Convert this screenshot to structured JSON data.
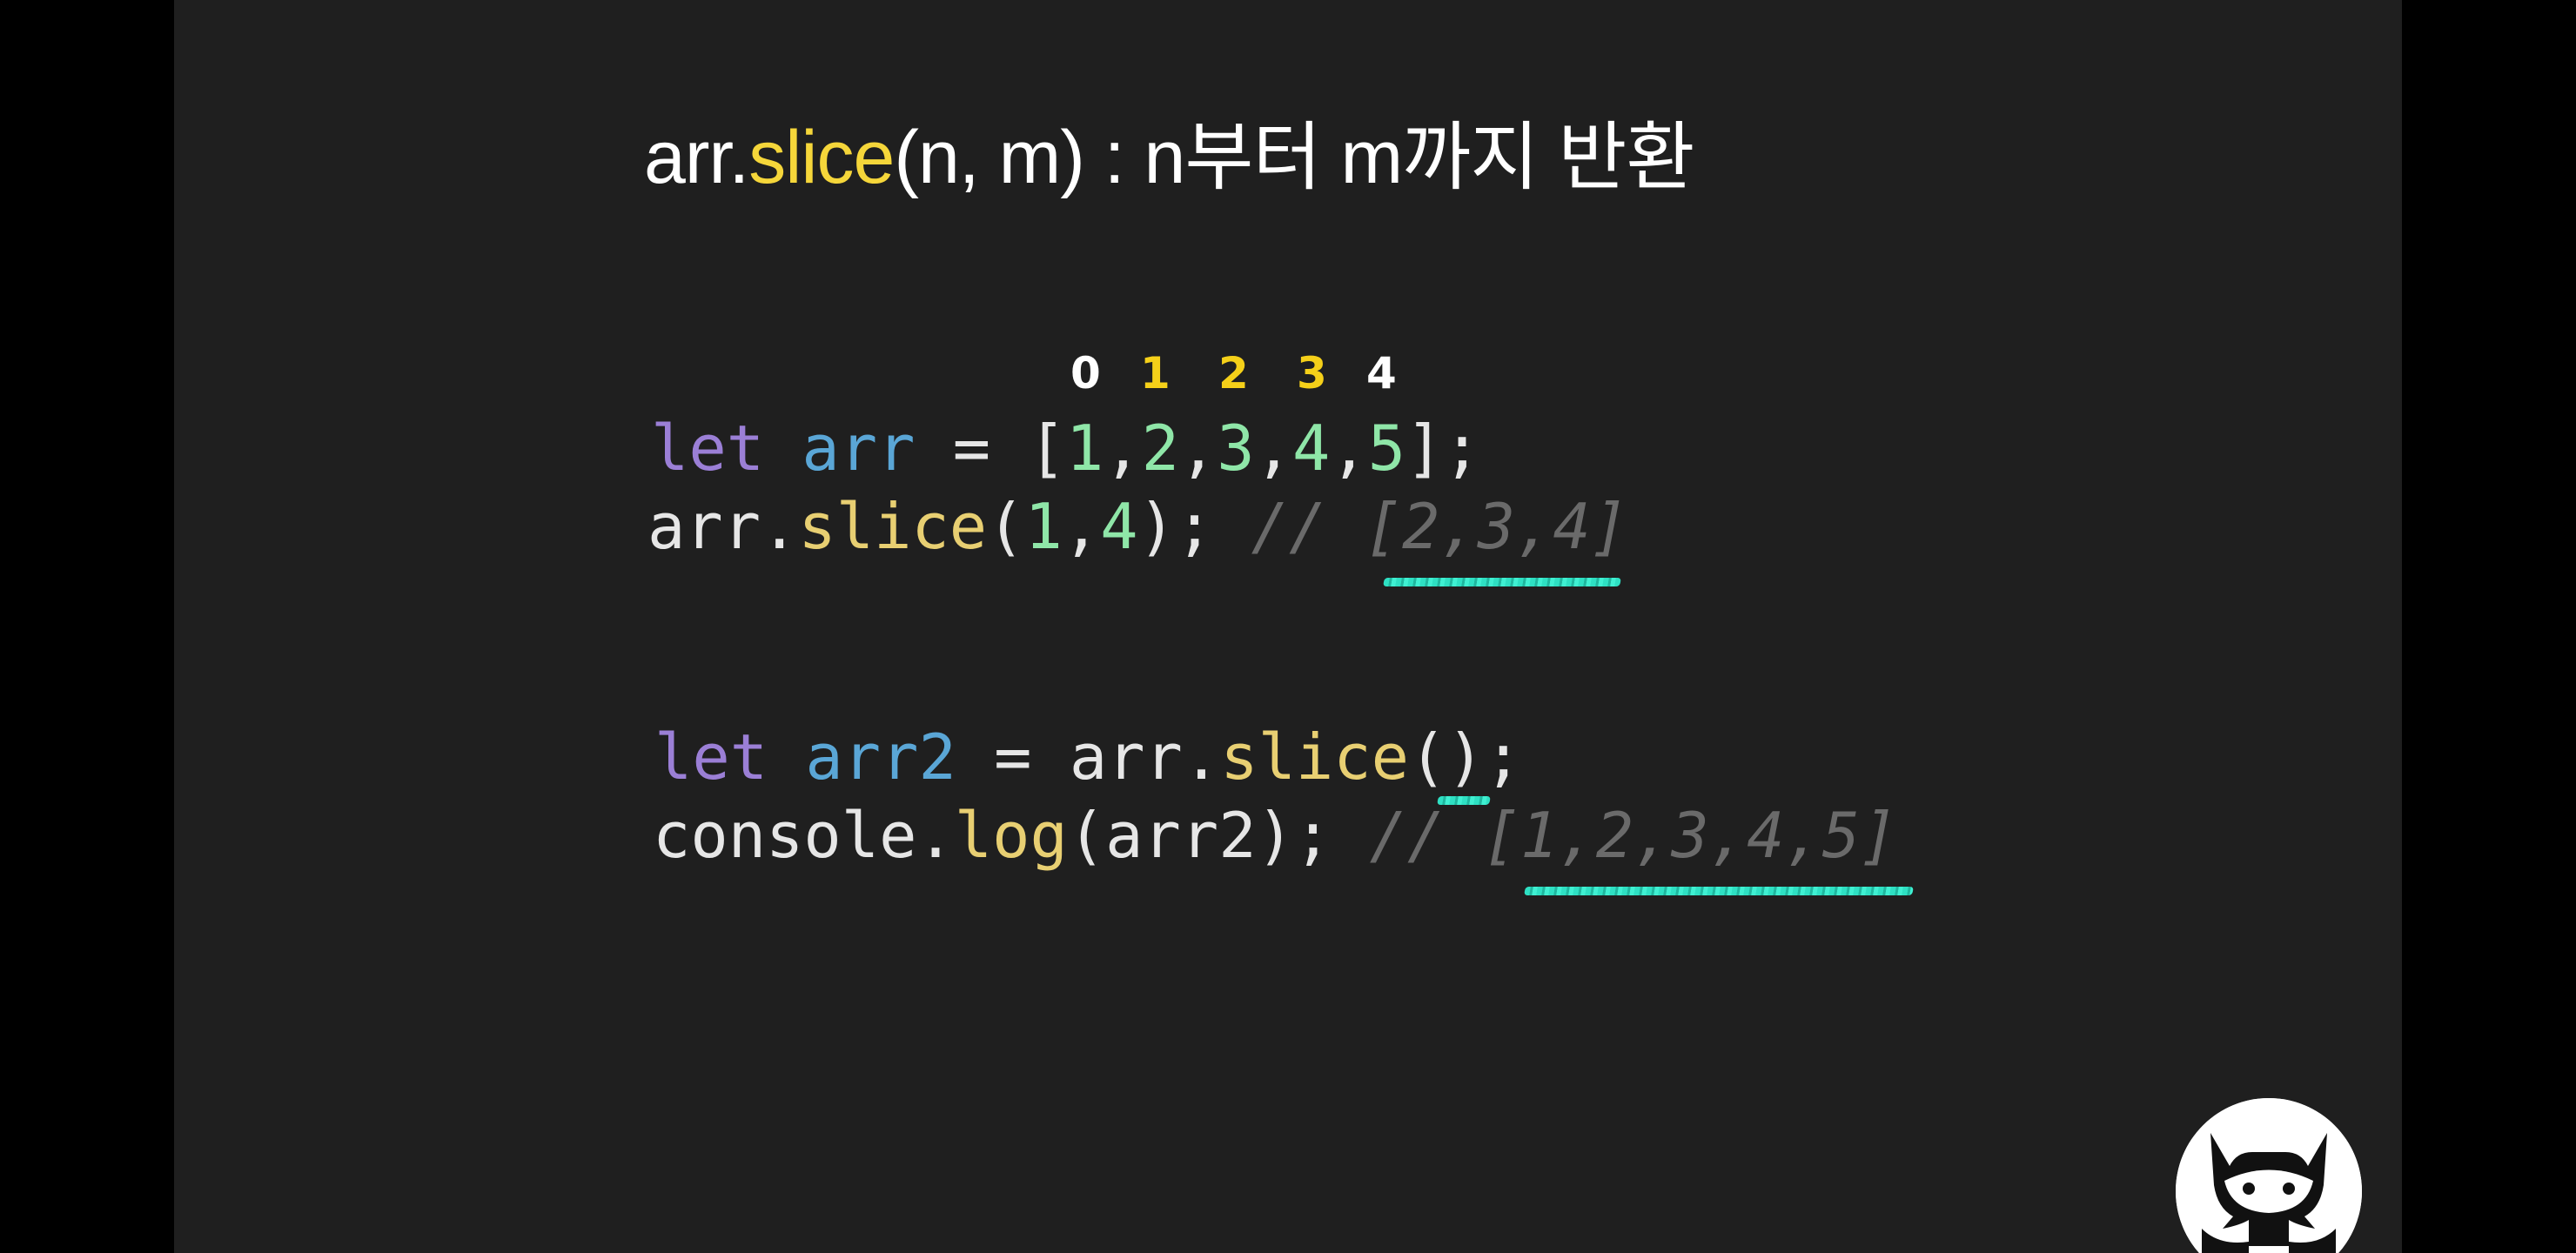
{
  "slide": {
    "title": {
      "prefix": "arr.",
      "method": "slice",
      "suffix": "(n, m) : n부터 m까지 반환"
    },
    "indices": [
      "0",
      "1",
      "2",
      "3",
      "4"
    ],
    "code_block_1": {
      "line1": {
        "keyword": "let",
        "var": "arr",
        "op": " = [",
        "nums": [
          "1",
          "2",
          "3",
          "4",
          "5"
        ],
        "end": "];"
      },
      "line2": {
        "obj": "arr.",
        "method": "slice",
        "open": "(",
        "arg1": "1",
        "comma": ",",
        "arg2": "4",
        "close": ");",
        "comment": "// [2,3,4]"
      }
    },
    "code_block_2": {
      "line1": {
        "keyword": "let",
        "var": "arr2",
        "op": " = arr.",
        "method": "slice",
        "end": "();"
      },
      "line2": {
        "obj": "console.",
        "method": "log",
        "args": "(arr2);",
        "comment": "// [1,2,3,4,5]"
      }
    },
    "colors": {
      "background": "#1f1f1f",
      "highlight_yellow": "#f5d63a",
      "underline_teal": "#2ee0c3"
    },
    "logo_icon": "devil-cat-icon"
  }
}
